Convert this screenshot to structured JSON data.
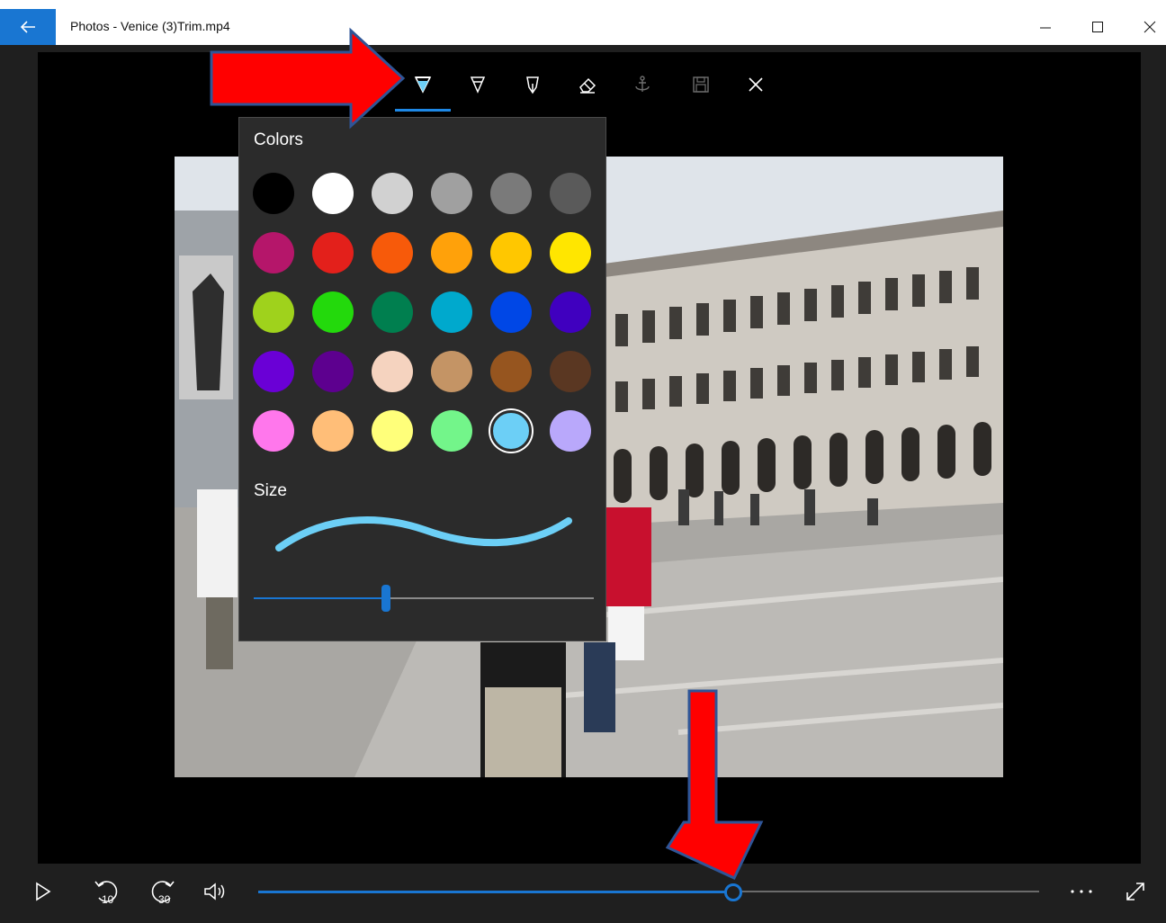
{
  "window": {
    "title": "Photos - Venice (3)Trim.mp4"
  },
  "ink_toolbar": {
    "tools": [
      {
        "name": "ballpoint-pen-icon",
        "active": true
      },
      {
        "name": "pencil-icon",
        "active": false
      },
      {
        "name": "calligraphy-pen-icon",
        "active": false
      },
      {
        "name": "eraser-icon",
        "active": false
      },
      {
        "name": "anchor-icon",
        "active": false
      },
      {
        "name": "save-icon",
        "active": false
      },
      {
        "name": "close-icon",
        "active": false
      }
    ]
  },
  "color_flyout": {
    "colors_label": "Colors",
    "size_label": "Size",
    "selected_color": "#6ccff6",
    "size_value": 0.39,
    "swatches": [
      [
        "#000000",
        "#ffffff",
        "#d1d1d1",
        "#a0a0a0",
        "#7a7a7a",
        "#5a5a5a"
      ],
      [
        "#b5166a",
        "#e3201b",
        "#f75a0a",
        "#ffa10a",
        "#ffc700",
        "#ffe600"
      ],
      [
        "#9fd21c",
        "#23d90c",
        "#007f4f",
        "#00a9cd",
        "#0047e6",
        "#4000bf"
      ],
      [
        "#6a00d6",
        "#5d008f",
        "#f5d3bf",
        "#c49465",
        "#96551f",
        "#5a3722"
      ],
      [
        "#ff77ec",
        "#ffbe78",
        "#ffff7a",
        "#73f58a",
        "#6ccff6",
        "#b9a8fb"
      ]
    ]
  },
  "playback": {
    "progress": 0.608,
    "rewind_seconds": "10",
    "forward_seconds": "30"
  },
  "colors": {
    "accent": "#1976d2",
    "annotation_arrow": "#ff0000"
  }
}
